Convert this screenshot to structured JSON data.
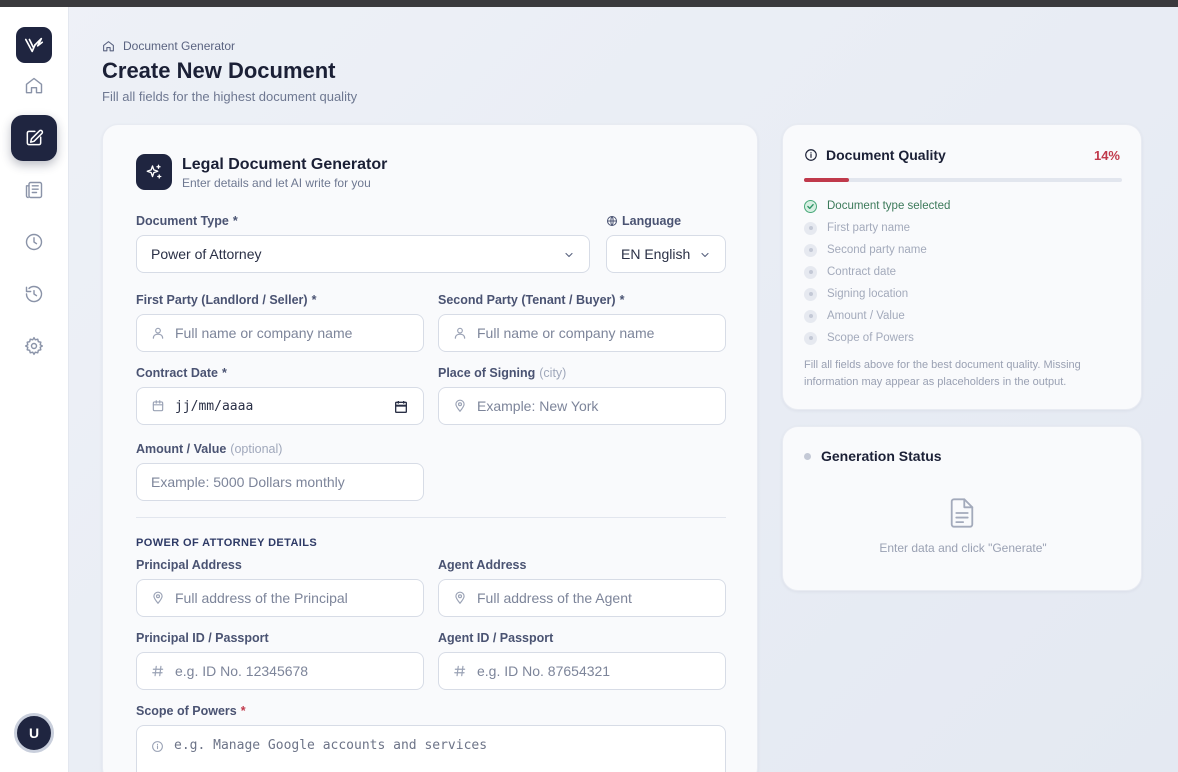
{
  "breadcrumb": {
    "label": "Document Generator"
  },
  "page": {
    "title": "Create New Document",
    "subtitle": "Fill all fields for the highest document quality"
  },
  "user": {
    "initial": "U"
  },
  "generator": {
    "title": "Legal Document Generator",
    "subtitle": "Enter details and let AI write for you"
  },
  "form": {
    "document_type": {
      "label": "Document Type",
      "required": "*",
      "value": "Power of Attorney"
    },
    "language": {
      "label": "Language",
      "value": "EN English"
    },
    "first_party": {
      "label": "First Party (Landlord / Seller)",
      "required": "*",
      "placeholder": "Full name or company name"
    },
    "second_party": {
      "label": "Second Party (Tenant / Buyer)",
      "required": "*",
      "placeholder": "Full name or company name"
    },
    "contract_date": {
      "label": "Contract Date",
      "required": "*",
      "value": "jj/mm/aaaa"
    },
    "place": {
      "label": "Place of Signing",
      "hint": "(city)",
      "placeholder": "Example: New York"
    },
    "amount": {
      "label": "Amount / Value",
      "hint": "(optional)",
      "placeholder": "Example: 5000 Dollars monthly"
    },
    "section_title": "POWER OF ATTORNEY DETAILS",
    "principal_address": {
      "label": "Principal Address",
      "placeholder": "Full address of the Principal"
    },
    "agent_address": {
      "label": "Agent Address",
      "placeholder": "Full address of the Agent"
    },
    "principal_id": {
      "label": "Principal ID / Passport",
      "placeholder": "e.g. ID No. 12345678"
    },
    "agent_id": {
      "label": "Agent ID / Passport",
      "placeholder": "e.g. ID No. 87654321"
    },
    "scope": {
      "label": "Scope of Powers",
      "required": "*",
      "placeholder": "e.g. Manage Google accounts and services"
    }
  },
  "quality": {
    "title": "Document Quality",
    "percent_label": "14%",
    "percent_value": 14,
    "items": [
      {
        "label": "Document type selected",
        "done": true
      },
      {
        "label": "First party name",
        "done": false
      },
      {
        "label": "Second party name",
        "done": false
      },
      {
        "label": "Contract date",
        "done": false
      },
      {
        "label": "Signing location",
        "done": false
      },
      {
        "label": "Amount / Value",
        "done": false
      },
      {
        "label": "Scope of Powers",
        "done": false
      }
    ],
    "note": "Fill all fields above for the best document quality. Missing information may appear as placeholders in the output."
  },
  "status": {
    "title": "Generation Status",
    "message": "Enter data and click \"Generate\""
  },
  "colors": {
    "accent": "#1f2540",
    "danger": "#c0394b",
    "success": "#2f9466"
  }
}
